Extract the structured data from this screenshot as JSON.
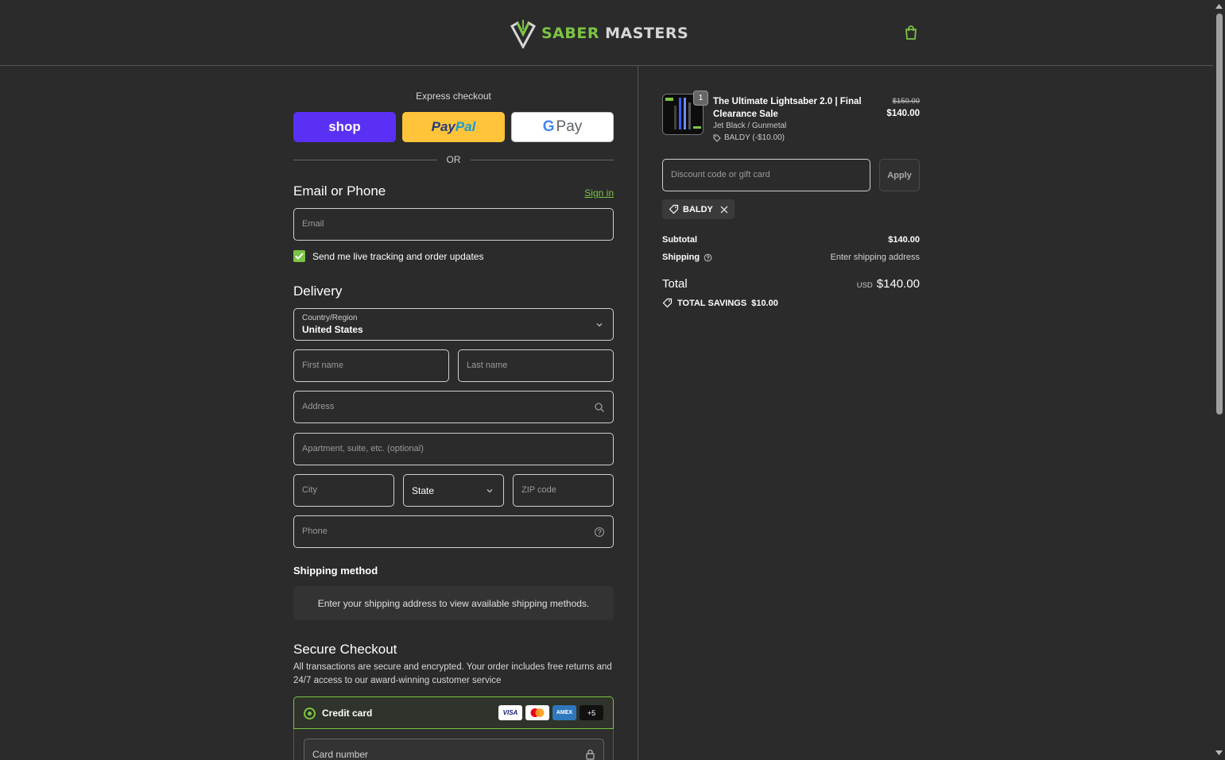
{
  "header": {
    "brand_part1": "SABER",
    "brand_part2": "MASTERS"
  },
  "express": {
    "title": "Express checkout",
    "shop_label": "shop",
    "paypal_label_1": "Pay",
    "paypal_label_2": "Pal",
    "gpay_g": "G",
    "gpay_label": "Pay",
    "or_label": "OR"
  },
  "contact": {
    "title": "Email or Phone",
    "sign_in": "Sign in",
    "email_placeholder": "Email",
    "updates_label": "Send me live tracking and order updates",
    "updates_checked": true
  },
  "delivery": {
    "title": "Delivery",
    "country_label": "Country/Region",
    "country_value": "United States",
    "first_name_placeholder": "First name",
    "last_name_placeholder": "Last name",
    "address_placeholder": "Address",
    "apartment_placeholder": "Apartment, suite, etc. (optional)",
    "city_placeholder": "City",
    "state_value": "State",
    "zip_placeholder": "ZIP code",
    "phone_placeholder": "Phone"
  },
  "shipping_method": {
    "title": "Shipping method",
    "notice": "Enter your shipping address to view available shipping methods."
  },
  "payment": {
    "title": "Secure Checkout",
    "description": "All transactions are secure and encrypted. Your order includes free returns and 24/7 access to our award-winning customer service",
    "credit_card_label": "Credit card",
    "card_brands": [
      "VISA",
      "",
      "AMEX",
      "+5"
    ],
    "card_number_placeholder": "Card number"
  },
  "order": {
    "quantity": "1",
    "product_title": "The Ultimate Lightsaber 2.0 | Final Clearance Sale",
    "variant": "Jet Black / Gunmetal",
    "discount_line": "BALDY (-$10.00)",
    "price_original": "$150.00",
    "price_current": "$140.00",
    "discount_placeholder": "Discount code or gift card",
    "apply_label": "Apply",
    "applied_code": "BALDY",
    "subtotal_label": "Subtotal",
    "subtotal_value": "$140.00",
    "shipping_label": "Shipping",
    "shipping_value": "Enter shipping address",
    "total_label": "Total",
    "total_currency": "USD",
    "total_value": "$140.00",
    "savings_label": "TOTAL SAVINGS",
    "savings_value": "$10.00"
  },
  "colors": {
    "accent": "#7cc444",
    "background": "#2b2b2b",
    "shop_pay": "#5a31f4",
    "paypal": "#ffc439"
  },
  "icons": [
    "brand-logo-icon",
    "shopping-bag-icon",
    "chevron-down-icon",
    "search-icon",
    "help-circle-icon",
    "tag-icon",
    "close-icon",
    "lock-icon",
    "checkmark-icon"
  ]
}
